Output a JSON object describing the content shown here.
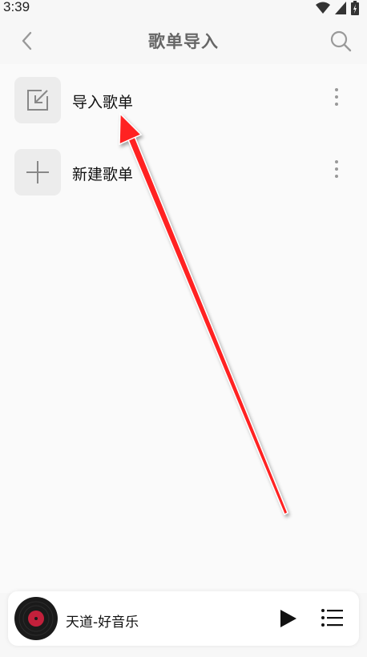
{
  "status_bar": {
    "time": "3:39"
  },
  "header": {
    "title": "歌单导入"
  },
  "list": [
    {
      "label": "导入歌单"
    },
    {
      "label": "新建歌单"
    }
  ],
  "player": {
    "song_title": "天道-好音乐"
  },
  "colors": {
    "arrow": "#e00000",
    "disc_label": "#c2203b"
  },
  "icons": [
    "back-icon",
    "search-icon",
    "import-icon",
    "plus-icon",
    "more-icon",
    "play-icon",
    "playlist-icon"
  ]
}
